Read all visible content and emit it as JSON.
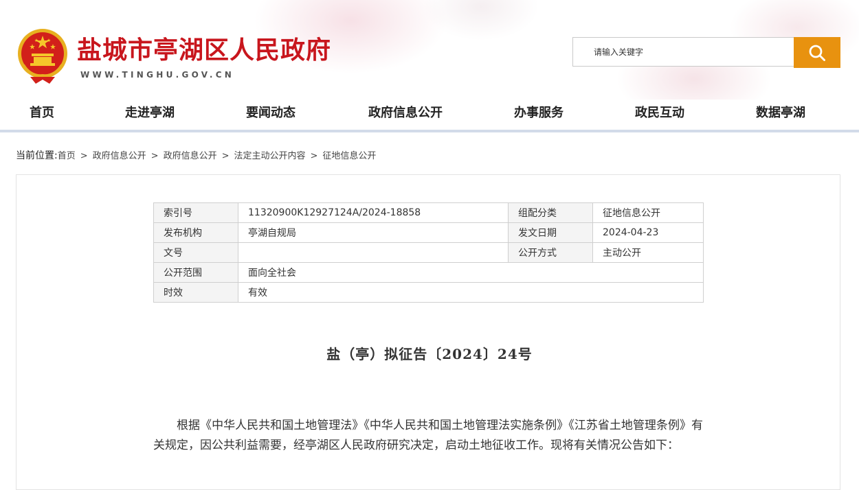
{
  "header": {
    "site_title": "盐城市亭湖区人民政府",
    "site_url": "WWW.TINGHU.GOV.CN",
    "emblem_icon": "national-emblem-icon",
    "search_placeholder": "请输入关键字",
    "search_icon": "search-icon"
  },
  "colors": {
    "brand_red": "#c8161d",
    "accent_orange": "#e8920f",
    "nav_divider": "#d2dbe9"
  },
  "nav": {
    "items": [
      "首页",
      "走进亭湖",
      "要闻动态",
      "政府信息公开",
      "办事服务",
      "政民互动",
      "数据亭湖"
    ]
  },
  "breadcrumb": {
    "label": "当前位置:",
    "items": [
      "首页",
      "政府信息公开",
      "政府信息公开",
      "法定主动公开内容",
      "征地信息公开"
    ],
    "separator": ">"
  },
  "info_table": {
    "index_label": "索引号",
    "index_value": "11320900K12927124A/2024-18858",
    "category_label": "组配分类",
    "category_value": "征地信息公开",
    "publisher_label": "发布机构",
    "publisher_value": "亭湖自规局",
    "date_label": "发文日期",
    "date_value": "2024-04-23",
    "docno_label": "文号",
    "docno_value": "",
    "method_label": "公开方式",
    "method_value": "主动公开",
    "scope_label": "公开范围",
    "scope_value": "面向全社会",
    "validity_label": "时效",
    "validity_value": "有效"
  },
  "document": {
    "title": "盐（亭）拟征告〔2024〕24号",
    "paragraph_1": "根据《中华人民共和国土地管理法》《中华人民共和国土地管理法实施条例》《江苏省土地管理条例》有关规定，因公共利益需要，经亭湖区人民政府研究决定，启动土地征收工作。现将有关情况公告如下："
  }
}
